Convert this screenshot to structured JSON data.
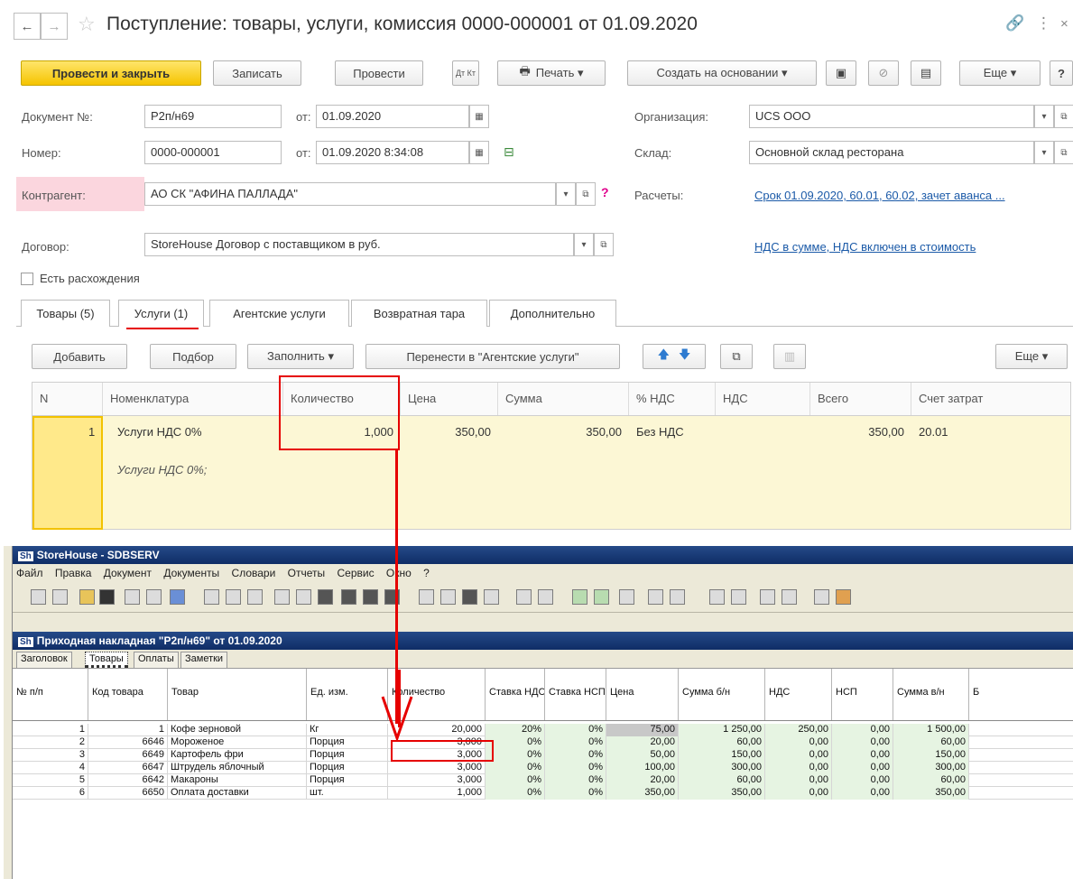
{
  "doc": {
    "title": "Поступление: товары, услуги, комиссия 0000-000001 от 01.09.2020",
    "toolbar": {
      "post_close": "Провести и закрыть",
      "save": "Записать",
      "post": "Провести",
      "dt_kt": "Дт Кт",
      "print": "Печать ▾",
      "create_based": "Создать на основании ▾",
      "more": "Еще ▾",
      "help": "?"
    },
    "fields": {
      "doc_no_label": "Документ №:",
      "doc_no_value": "Р2п/н69",
      "from_label_1": "от:",
      "from_value_1": "01.09.2020",
      "number_label": "Номер:",
      "number_value": "0000-000001",
      "from_label_2": "от:",
      "from_value_2": "01.09.2020  8:34:08",
      "org_label": "Организация:",
      "org_value": "UCS OOO",
      "warehouse_label": "Склад:",
      "warehouse_value": "Основной склад ресторана",
      "counterparty_label": "Контрагент:",
      "counterparty_value": "АО СК \"АФИНА ПАЛЛАДА\"",
      "settlements_label": "Расчеты:",
      "settlements_link": "Срок 01.09.2020, 60.01, 60.02, зачет аванса ...",
      "contract_label": "Договор:",
      "contract_value": "StoreHouse Договор с поставщиком в руб.",
      "vat_link": "НДС в сумме, НДС включен в стоимость",
      "discrepancy_label": "Есть расхождения"
    },
    "tabs": [
      "Товары (5)",
      "Услуги (1)",
      "Агентские услуги",
      "Возвратная тара",
      "Дополнительно"
    ],
    "table_toolbar": {
      "add": "Добавить",
      "selection": "Подбор",
      "fill": "Заполнить ▾",
      "move": "Перенести в \"Агентские услуги\"",
      "more": "Еще ▾"
    },
    "columns": [
      "N",
      "Номенклатура",
      "Количество",
      "Цена",
      "Сумма",
      "% НДС",
      "НДС",
      "Всего",
      "Счет затрат"
    ],
    "row": {
      "n": "1",
      "item": "Услуги НДС 0%",
      "item_desc": "Услуги НДС 0%;",
      "qty": "1,000",
      "price": "350,00",
      "sum": "350,00",
      "vat_rate": "Без НДС",
      "vat": "",
      "total": "350,00",
      "account": "20.01"
    }
  },
  "sh": {
    "title": "StoreHouse - SDBSERV",
    "menu": [
      "Файл",
      "Правка",
      "Документ",
      "Документы",
      "Словари",
      "Отчеты",
      "Сервис",
      "Окно",
      "?"
    ],
    "subtitle": "Приходная накладная \"Р2п/н69\" от 01.09.2020",
    "tabs": [
      "Заголовок",
      "Товары",
      "Оплаты",
      "Заметки"
    ],
    "columns": [
      "№ п/п",
      "Код товара",
      "Товар",
      "Ед. изм.",
      "Количество",
      "Ставка НДС",
      "Ставка НСП",
      "Цена",
      "Сумма б/н",
      "НДС",
      "НСП",
      "Сумма в/н",
      "Б"
    ],
    "rows": [
      [
        "1",
        "1",
        "Кофе зерновой",
        "Кг",
        "20,000",
        "20%",
        "0%",
        "75,00",
        "1 250,00",
        "250,00",
        "0,00",
        "1 500,00"
      ],
      [
        "2",
        "6646",
        "Мороженое",
        "Порция",
        "3,000",
        "0%",
        "0%",
        "20,00",
        "60,00",
        "0,00",
        "0,00",
        "60,00"
      ],
      [
        "3",
        "6649",
        "Картофель фри",
        "Порция",
        "3,000",
        "0%",
        "0%",
        "50,00",
        "150,00",
        "0,00",
        "0,00",
        "150,00"
      ],
      [
        "4",
        "6647",
        "Штрудель яблочный",
        "Порция",
        "3,000",
        "0%",
        "0%",
        "100,00",
        "300,00",
        "0,00",
        "0,00",
        "300,00"
      ],
      [
        "5",
        "6642",
        "Макароны",
        "Порция",
        "3,000",
        "0%",
        "0%",
        "20,00",
        "60,00",
        "0,00",
        "0,00",
        "60,00"
      ],
      [
        "6",
        "6650",
        "Оплата доставки",
        "шт.",
        "1,000",
        "0%",
        "0%",
        "350,00",
        "350,00",
        "0,00",
        "0,00",
        "350,00"
      ]
    ]
  }
}
